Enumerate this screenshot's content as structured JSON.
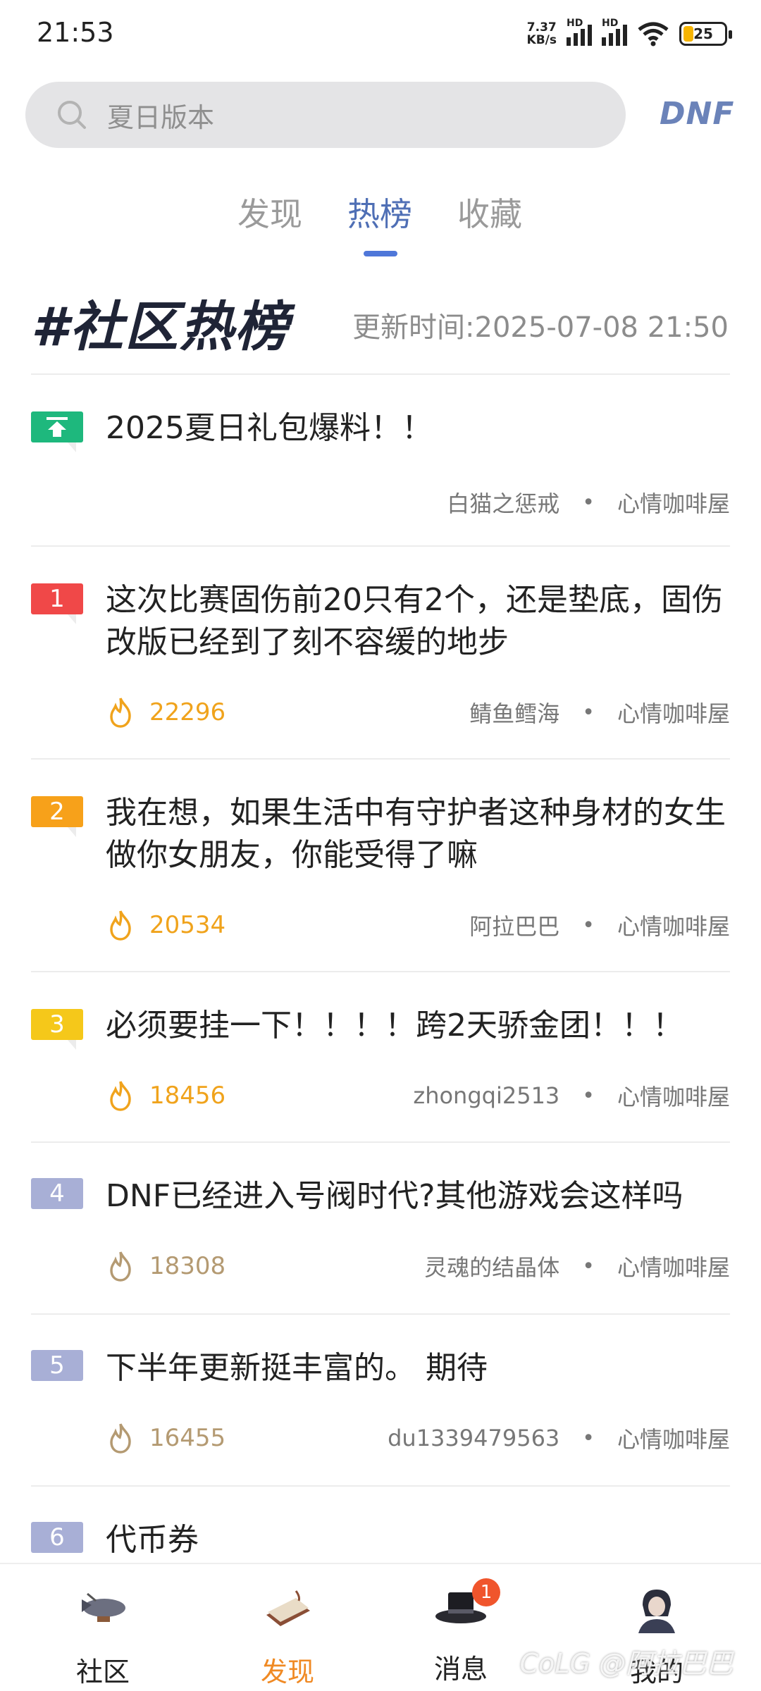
{
  "status": {
    "time": "21:53",
    "net_speed_top": "7.37",
    "net_speed_bottom": "KB/s",
    "hd": "HD",
    "battery": "25"
  },
  "search": {
    "placeholder": "夏日版本",
    "logo": "DNF"
  },
  "tabs": [
    {
      "label": "发现"
    },
    {
      "label": "热榜"
    },
    {
      "label": "收藏"
    }
  ],
  "hot": {
    "title": "#社区热榜",
    "updated": "更新时间:2025-07-08 21:50"
  },
  "items": [
    {
      "rank": "top",
      "title": "2025夏日礼包爆料！！",
      "author": "白猫之惩戒",
      "board": "心情咖啡屋"
    },
    {
      "rank": "1",
      "title": "这次比赛固伤前20只有2个，还是垫底，固伤改版已经到了刻不容缓的地步",
      "heat": "22296",
      "author": "鲭鱼鳕海",
      "board": "心情咖啡屋"
    },
    {
      "rank": "2",
      "title": "我在想，如果生活中有守护者这种身材的女生做你女朋友，你能受得了嘛",
      "heat": "20534",
      "author": "阿拉巴巴",
      "board": "心情咖啡屋"
    },
    {
      "rank": "3",
      "title": "必须要挂一下！！！！跨2天骄金团！！！",
      "heat": "18456",
      "author": "zhongqi2513",
      "board": "心情咖啡屋"
    },
    {
      "rank": "4",
      "title": "DNF已经进入号阀时代?其他游戏会这样吗",
      "heat": "18308",
      "author": "灵魂的结晶体",
      "board": "心情咖啡屋"
    },
    {
      "rank": "5",
      "title": "下半年更新挺丰富的。 期待",
      "heat": "16455",
      "author": "du1339479563",
      "board": "心情咖啡屋"
    },
    {
      "rank": "6",
      "title": "代币券"
    }
  ],
  "dot": "•",
  "nav": [
    {
      "label": "社区",
      "icon": "airship-icon"
    },
    {
      "label": "发现",
      "icon": "book-icon"
    },
    {
      "label": "消息",
      "icon": "top-hat-icon",
      "badge": "1"
    },
    {
      "label": "我的",
      "icon": "character-avatar-icon"
    }
  ],
  "colors": {
    "accent": "#4f6fb5",
    "heat_hot": "#f0a31c",
    "heat_warm": "#b49a72",
    "nav_active": "#f08a24"
  },
  "watermark": "CoLG @阿拉巴巴"
}
